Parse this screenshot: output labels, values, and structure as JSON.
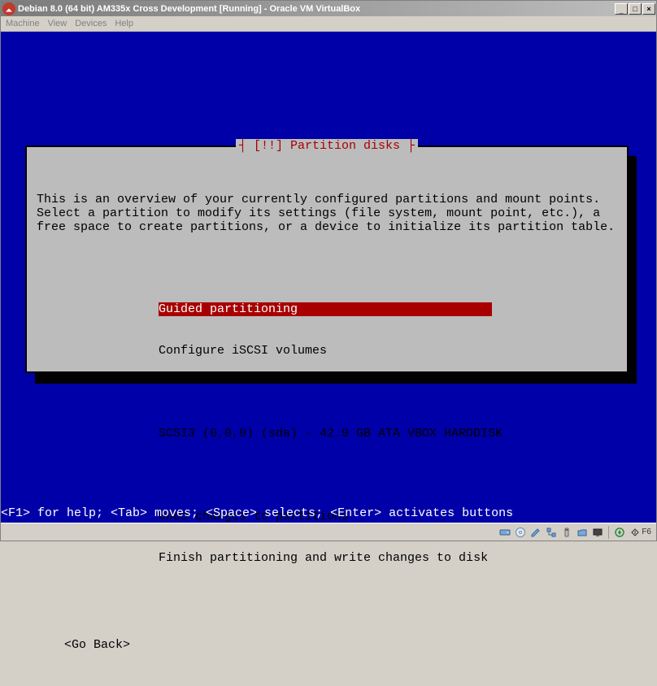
{
  "vbox": {
    "title": "Debian 8.0 (64 bit) AM335x Cross Development [Running] - Oracle VM VirtualBox",
    "menu": {
      "machine": "Machine",
      "view": "View",
      "devices": "Devices",
      "help": "Help"
    },
    "win_min_glyph": "__",
    "win_max_glyph": "□",
    "win_close_glyph": "×",
    "status_hostkey": "F6"
  },
  "installer": {
    "dialog_title": "[!!] Partition disks",
    "intro": "This is an overview of your currently configured partitions and mount points. Select a partition to modify its settings (file system, mount point, etc.), a free space to create partitions, or a device to initialize its partition table.",
    "items": {
      "guided": "Guided partitioning",
      "iscsi": "Configure iSCSI volumes",
      "disk0": "SCSI3 (0,0,0) (sda) - 42.9 GB ATA VBOX HARDDISK",
      "undo": "Undo changes to partitions",
      "finish": "Finish partitioning and write changes to disk"
    },
    "go_back": "<Go Back>",
    "helpbar": "<F1> for help; <Tab> moves; <Space> selects; <Enter> activates buttons"
  }
}
